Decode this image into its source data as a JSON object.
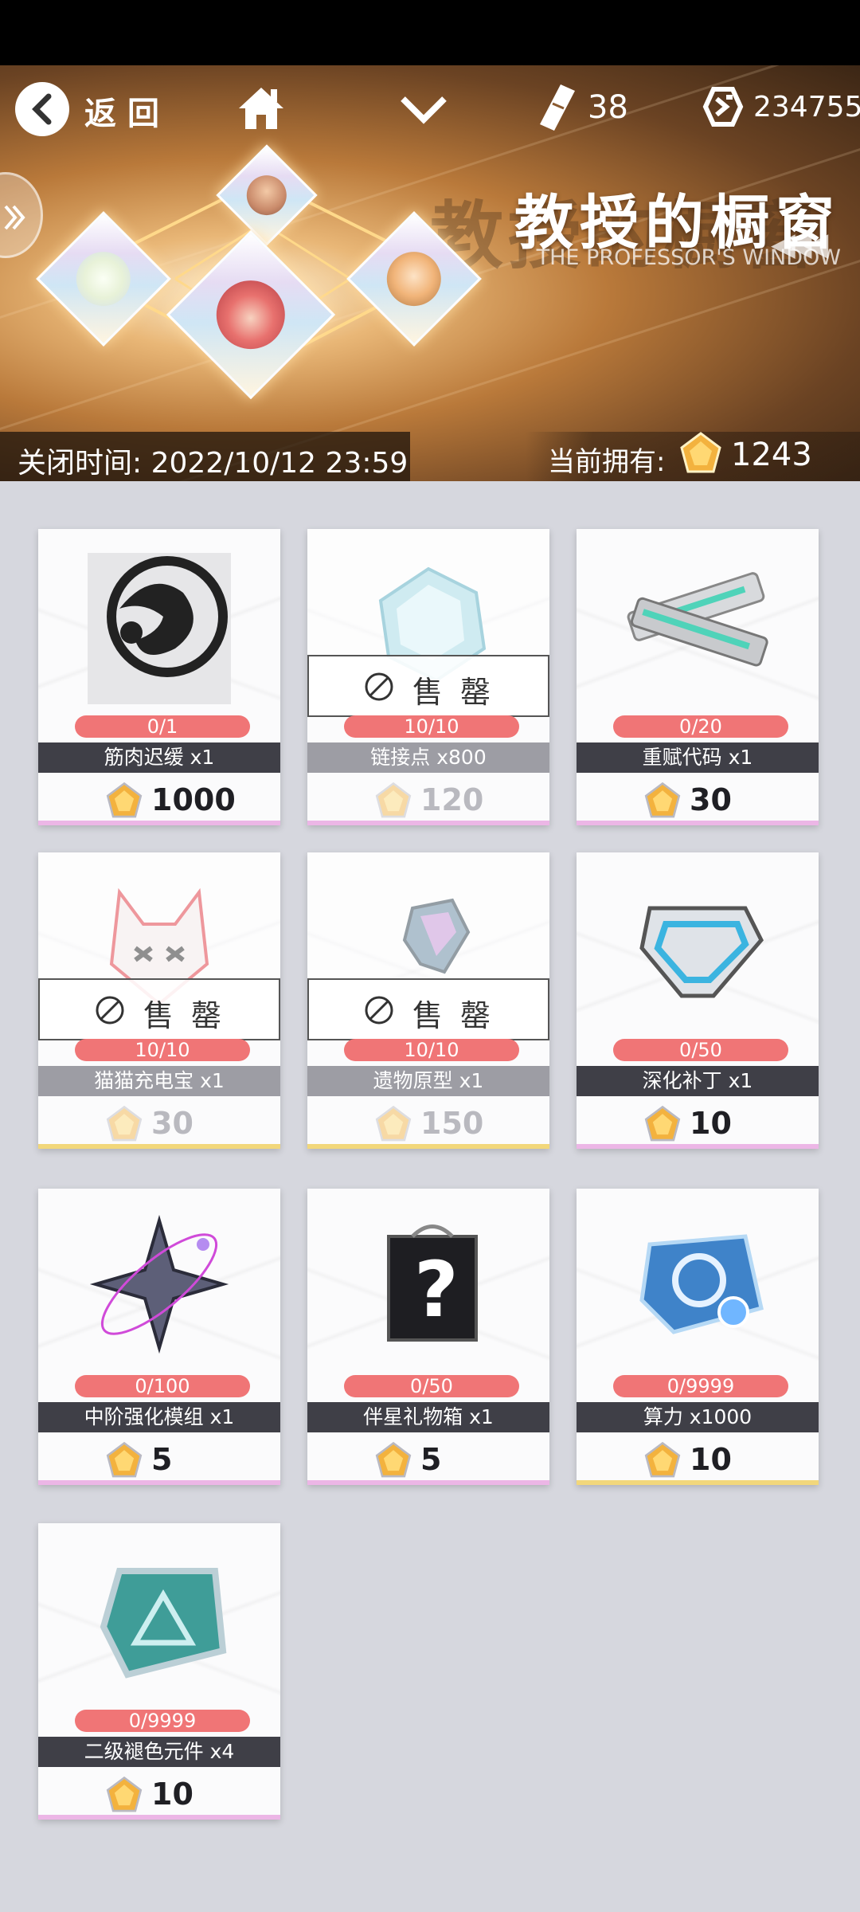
{
  "topbar": {
    "back_label": "返回",
    "stamina": "38",
    "coins": "234755"
  },
  "banner": {
    "title": "教授的橱窗",
    "subtitle": "THE PROFESSOR'S WINDOW",
    "close_time": "关闭时间: 2022/10/12 23:59",
    "own_label": "当前拥有:",
    "own_value": "1243"
  },
  "sold_out_label": "售罄",
  "items": [
    {
      "name": "筋肉迟缓 x1",
      "stock": "0/1",
      "price": "1000",
      "sold_out": false,
      "underline": "pink",
      "icon": "muscle-emblem-icon"
    },
    {
      "name": "链接点 x800",
      "stock": "10/10",
      "price": "120",
      "sold_out": true,
      "underline": "pink",
      "icon": "crystal-icon"
    },
    {
      "name": "重赋代码 x1",
      "stock": "0/20",
      "price": "30",
      "sold_out": false,
      "underline": "pink",
      "icon": "code-bars-icon"
    },
    {
      "name": "猫猫充电宝 x1",
      "stock": "10/10",
      "price": "30",
      "sold_out": true,
      "underline": "yellow",
      "icon": "cat-mask-icon"
    },
    {
      "name": "遗物原型 x1",
      "stock": "10/10",
      "price": "150",
      "sold_out": true,
      "underline": "yellow",
      "icon": "relic-icon"
    },
    {
      "name": "深化补丁 x1",
      "stock": "0/50",
      "price": "10",
      "sold_out": false,
      "underline": "pink",
      "icon": "patch-icon"
    },
    {
      "name": "中阶强化模组 x1",
      "stock": "0/100",
      "price": "5",
      "sold_out": false,
      "underline": "pink",
      "icon": "star-module-icon"
    },
    {
      "name": "伴星礼物箱 x1",
      "stock": "0/50",
      "price": "5",
      "sold_out": false,
      "underline": "pink",
      "icon": "mystery-box-icon"
    },
    {
      "name": "算力 x1000",
      "stock": "0/9999",
      "price": "10",
      "sold_out": false,
      "underline": "yellow",
      "icon": "compute-chip-icon"
    },
    {
      "name": "二级褪色元件 x4",
      "stock": "0/9999",
      "price": "10",
      "sold_out": false,
      "underline": "pink",
      "icon": "faded-component-icon"
    }
  ],
  "colors": {
    "stock_pill": "#f07576",
    "name_bar": "#3f3f47",
    "background": "#d6d7de"
  }
}
